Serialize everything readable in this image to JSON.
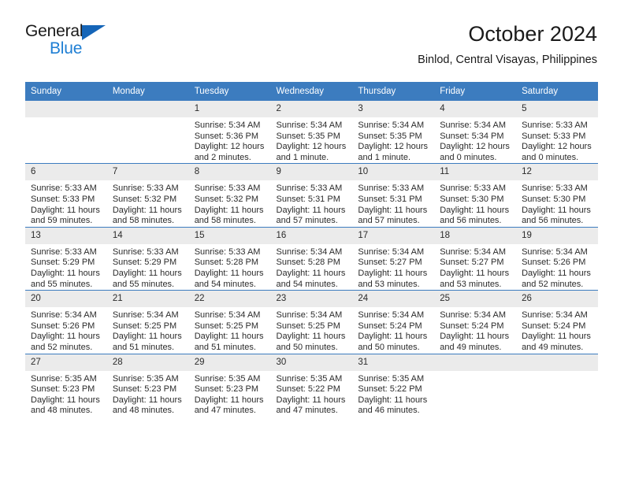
{
  "logo": {
    "word_top": "General",
    "word_bottom": "Blue",
    "triangle_color": "#1565b8",
    "blue_color": "#1f7fd4"
  },
  "header": {
    "title": "October 2024",
    "subtitle": "Binlod, Central Visayas, Philippines"
  },
  "theme": {
    "header_blue": "#3c7cbf",
    "daynum_gray": "#ebebeb",
    "cell_white": "#ffffff",
    "text": "#2b2b2b"
  },
  "weekday_headers": [
    "Sunday",
    "Monday",
    "Tuesday",
    "Wednesday",
    "Thursday",
    "Friday",
    "Saturday"
  ],
  "labels": {
    "sunrise_prefix": "Sunrise:",
    "sunset_prefix": "Sunset:",
    "daylight_prefix": "Daylight:"
  },
  "weeks": [
    [
      {
        "day": "",
        "blank": true,
        "l1": "",
        "l2": "",
        "l3": "",
        "l4": ""
      },
      {
        "day": "",
        "blank": true,
        "l1": "",
        "l2": "",
        "l3": "",
        "l4": ""
      },
      {
        "day": "1",
        "l1": "Sunrise: 5:34 AM",
        "l2": "Sunset: 5:36 PM",
        "l3": "Daylight: 12 hours",
        "l4": "and 2 minutes."
      },
      {
        "day": "2",
        "l1": "Sunrise: 5:34 AM",
        "l2": "Sunset: 5:35 PM",
        "l3": "Daylight: 12 hours",
        "l4": "and 1 minute."
      },
      {
        "day": "3",
        "l1": "Sunrise: 5:34 AM",
        "l2": "Sunset: 5:35 PM",
        "l3": "Daylight: 12 hours",
        "l4": "and 1 minute."
      },
      {
        "day": "4",
        "l1": "Sunrise: 5:34 AM",
        "l2": "Sunset: 5:34 PM",
        "l3": "Daylight: 12 hours",
        "l4": "and 0 minutes."
      },
      {
        "day": "5",
        "l1": "Sunrise: 5:33 AM",
        "l2": "Sunset: 5:33 PM",
        "l3": "Daylight: 12 hours",
        "l4": "and 0 minutes."
      }
    ],
    [
      {
        "day": "6",
        "l1": "Sunrise: 5:33 AM",
        "l2": "Sunset: 5:33 PM",
        "l3": "Daylight: 11 hours",
        "l4": "and 59 minutes."
      },
      {
        "day": "7",
        "l1": "Sunrise: 5:33 AM",
        "l2": "Sunset: 5:32 PM",
        "l3": "Daylight: 11 hours",
        "l4": "and 58 minutes."
      },
      {
        "day": "8",
        "l1": "Sunrise: 5:33 AM",
        "l2": "Sunset: 5:32 PM",
        "l3": "Daylight: 11 hours",
        "l4": "and 58 minutes."
      },
      {
        "day": "9",
        "l1": "Sunrise: 5:33 AM",
        "l2": "Sunset: 5:31 PM",
        "l3": "Daylight: 11 hours",
        "l4": "and 57 minutes."
      },
      {
        "day": "10",
        "l1": "Sunrise: 5:33 AM",
        "l2": "Sunset: 5:31 PM",
        "l3": "Daylight: 11 hours",
        "l4": "and 57 minutes."
      },
      {
        "day": "11",
        "l1": "Sunrise: 5:33 AM",
        "l2": "Sunset: 5:30 PM",
        "l3": "Daylight: 11 hours",
        "l4": "and 56 minutes."
      },
      {
        "day": "12",
        "l1": "Sunrise: 5:33 AM",
        "l2": "Sunset: 5:30 PM",
        "l3": "Daylight: 11 hours",
        "l4": "and 56 minutes."
      }
    ],
    [
      {
        "day": "13",
        "l1": "Sunrise: 5:33 AM",
        "l2": "Sunset: 5:29 PM",
        "l3": "Daylight: 11 hours",
        "l4": "and 55 minutes."
      },
      {
        "day": "14",
        "l1": "Sunrise: 5:33 AM",
        "l2": "Sunset: 5:29 PM",
        "l3": "Daylight: 11 hours",
        "l4": "and 55 minutes."
      },
      {
        "day": "15",
        "l1": "Sunrise: 5:33 AM",
        "l2": "Sunset: 5:28 PM",
        "l3": "Daylight: 11 hours",
        "l4": "and 54 minutes."
      },
      {
        "day": "16",
        "l1": "Sunrise: 5:34 AM",
        "l2": "Sunset: 5:28 PM",
        "l3": "Daylight: 11 hours",
        "l4": "and 54 minutes."
      },
      {
        "day": "17",
        "l1": "Sunrise: 5:34 AM",
        "l2": "Sunset: 5:27 PM",
        "l3": "Daylight: 11 hours",
        "l4": "and 53 minutes."
      },
      {
        "day": "18",
        "l1": "Sunrise: 5:34 AM",
        "l2": "Sunset: 5:27 PM",
        "l3": "Daylight: 11 hours",
        "l4": "and 53 minutes."
      },
      {
        "day": "19",
        "l1": "Sunrise: 5:34 AM",
        "l2": "Sunset: 5:26 PM",
        "l3": "Daylight: 11 hours",
        "l4": "and 52 minutes."
      }
    ],
    [
      {
        "day": "20",
        "l1": "Sunrise: 5:34 AM",
        "l2": "Sunset: 5:26 PM",
        "l3": "Daylight: 11 hours",
        "l4": "and 52 minutes."
      },
      {
        "day": "21",
        "l1": "Sunrise: 5:34 AM",
        "l2": "Sunset: 5:25 PM",
        "l3": "Daylight: 11 hours",
        "l4": "and 51 minutes."
      },
      {
        "day": "22",
        "l1": "Sunrise: 5:34 AM",
        "l2": "Sunset: 5:25 PM",
        "l3": "Daylight: 11 hours",
        "l4": "and 51 minutes."
      },
      {
        "day": "23",
        "l1": "Sunrise: 5:34 AM",
        "l2": "Sunset: 5:25 PM",
        "l3": "Daylight: 11 hours",
        "l4": "and 50 minutes."
      },
      {
        "day": "24",
        "l1": "Sunrise: 5:34 AM",
        "l2": "Sunset: 5:24 PM",
        "l3": "Daylight: 11 hours",
        "l4": "and 50 minutes."
      },
      {
        "day": "25",
        "l1": "Sunrise: 5:34 AM",
        "l2": "Sunset: 5:24 PM",
        "l3": "Daylight: 11 hours",
        "l4": "and 49 minutes."
      },
      {
        "day": "26",
        "l1": "Sunrise: 5:34 AM",
        "l2": "Sunset: 5:24 PM",
        "l3": "Daylight: 11 hours",
        "l4": "and 49 minutes."
      }
    ],
    [
      {
        "day": "27",
        "l1": "Sunrise: 5:35 AM",
        "l2": "Sunset: 5:23 PM",
        "l3": "Daylight: 11 hours",
        "l4": "and 48 minutes."
      },
      {
        "day": "28",
        "l1": "Sunrise: 5:35 AM",
        "l2": "Sunset: 5:23 PM",
        "l3": "Daylight: 11 hours",
        "l4": "and 48 minutes."
      },
      {
        "day": "29",
        "l1": "Sunrise: 5:35 AM",
        "l2": "Sunset: 5:23 PM",
        "l3": "Daylight: 11 hours",
        "l4": "and 47 minutes."
      },
      {
        "day": "30",
        "l1": "Sunrise: 5:35 AM",
        "l2": "Sunset: 5:22 PM",
        "l3": "Daylight: 11 hours",
        "l4": "and 47 minutes."
      },
      {
        "day": "31",
        "l1": "Sunrise: 5:35 AM",
        "l2": "Sunset: 5:22 PM",
        "l3": "Daylight: 11 hours",
        "l4": "and 46 minutes."
      },
      {
        "day": "",
        "blank": true,
        "l1": "",
        "l2": "",
        "l3": "",
        "l4": ""
      },
      {
        "day": "",
        "blank": true,
        "l1": "",
        "l2": "",
        "l3": "",
        "l4": ""
      }
    ]
  ]
}
